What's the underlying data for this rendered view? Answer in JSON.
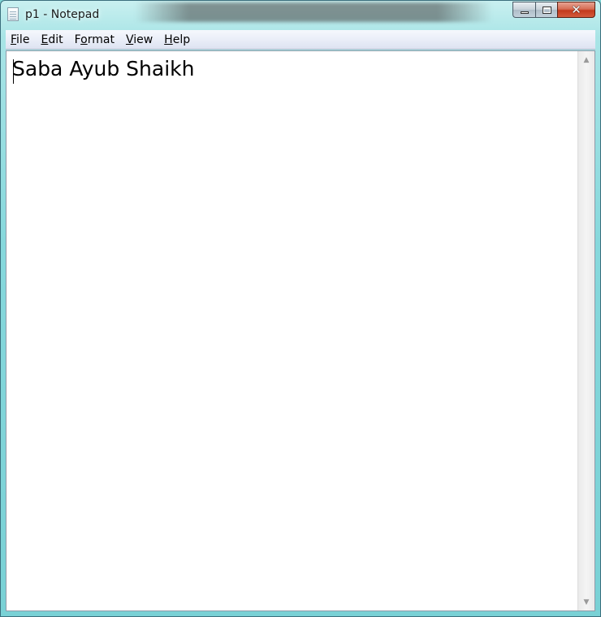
{
  "window": {
    "title": "p1 - Notepad"
  },
  "caption": {
    "close_glyph": "✕"
  },
  "menu": [
    {
      "underline": "F",
      "rest": "ile"
    },
    {
      "underline": "E",
      "rest": "dit"
    },
    {
      "underline": "o",
      "prefix": "F",
      "rest": "rmat"
    },
    {
      "underline": "V",
      "rest": "iew"
    },
    {
      "underline": "H",
      "rest": "elp"
    }
  ],
  "editor": {
    "content": "Saba Ayub Shaikh"
  },
  "scrollbar": {
    "up_glyph": "▲",
    "down_glyph": "▼"
  }
}
